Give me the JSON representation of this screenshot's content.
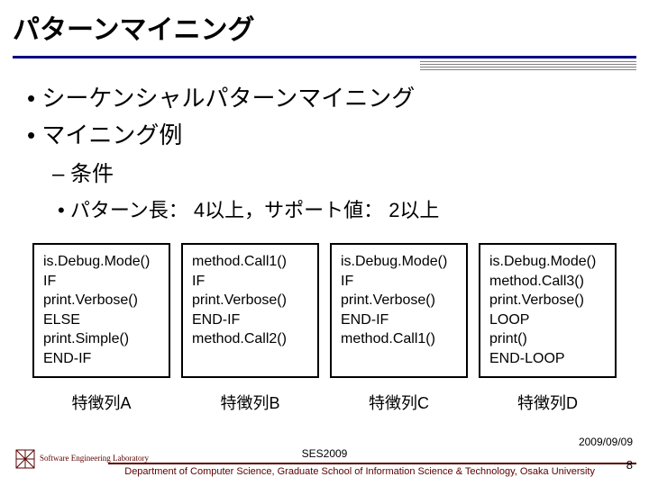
{
  "title": "パターンマイニング",
  "bullets": [
    "シーケンシャルパターンマイニング",
    "マイニング例"
  ],
  "sub": "条件",
  "subsub": "パターン長： 4以上，サポート値： 2以上",
  "boxes": [
    {
      "lines": "is.Debug.Mode()\nIF\nprint.Verbose()\nELSE\nprint.Simple()\nEND-IF",
      "label": "特徴列A"
    },
    {
      "lines": "method.Call1()\nIF\nprint.Verbose()\nEND-IF\nmethod.Call2()",
      "label": "特徴列B"
    },
    {
      "lines": "is.Debug.Mode()\nIF\nprint.Verbose()\nEND-IF\nmethod.Call1()",
      "label": "特徴列C"
    },
    {
      "lines": "is.Debug.Mode()\nmethod.Call3()\nprint.Verbose()\nLOOP\nprint()\nEND-LOOP",
      "label": "特徴列D"
    }
  ],
  "footer": {
    "conference": "SES2009",
    "date": "2009/09/09",
    "dept": "Department of Computer Science, Graduate School of Information Science & Technology, Osaka University",
    "page": "8",
    "logo_text": "Software\nEngineering\nLaboratory"
  }
}
